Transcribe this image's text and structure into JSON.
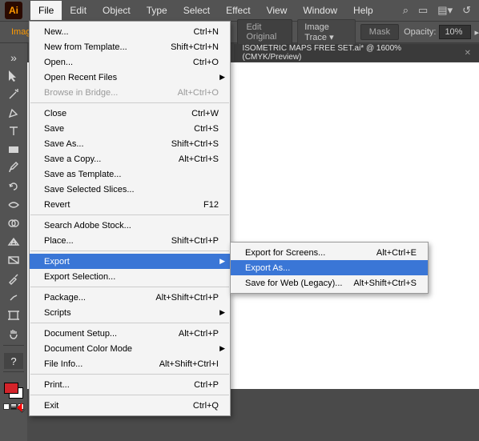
{
  "app": {
    "abbrev": "Ai"
  },
  "menubar": [
    "File",
    "Edit",
    "Object",
    "Type",
    "Select",
    "Effect",
    "View",
    "Window",
    "Help"
  ],
  "menubar_active_index": 0,
  "optbar": {
    "left_label": "Imag",
    "edit_original": "Edit Original",
    "image_trace": "Image Trace",
    "mask": "Mask",
    "opacity_label": "Opacity:",
    "opacity_value": "10%"
  },
  "tab": {
    "title": "ISOMETRIC MAPS FREE SET.ai* @ 1600% (CMYK/Preview)"
  },
  "file_menu": [
    {
      "label": "New...",
      "shortcut": "Ctrl+N"
    },
    {
      "label": "New from Template...",
      "shortcut": "Shift+Ctrl+N"
    },
    {
      "label": "Open...",
      "shortcut": "Ctrl+O"
    },
    {
      "label": "Open Recent Files",
      "submenu": true
    },
    {
      "label": "Browse in Bridge...",
      "shortcut": "Alt+Ctrl+O",
      "disabled": true
    },
    {
      "sep": true
    },
    {
      "label": "Close",
      "shortcut": "Ctrl+W"
    },
    {
      "label": "Save",
      "shortcut": "Ctrl+S"
    },
    {
      "label": "Save As...",
      "shortcut": "Shift+Ctrl+S"
    },
    {
      "label": "Save a Copy...",
      "shortcut": "Alt+Ctrl+S"
    },
    {
      "label": "Save as Template..."
    },
    {
      "label": "Save Selected Slices..."
    },
    {
      "label": "Revert",
      "shortcut": "F12"
    },
    {
      "sep": true
    },
    {
      "label": "Search Adobe Stock..."
    },
    {
      "label": "Place...",
      "shortcut": "Shift+Ctrl+P"
    },
    {
      "sep": true
    },
    {
      "label": "Export",
      "submenu": true,
      "hl": true
    },
    {
      "label": "Export Selection..."
    },
    {
      "sep": true
    },
    {
      "label": "Package...",
      "shortcut": "Alt+Shift+Ctrl+P"
    },
    {
      "label": "Scripts",
      "submenu": true
    },
    {
      "sep": true
    },
    {
      "label": "Document Setup...",
      "shortcut": "Alt+Ctrl+P"
    },
    {
      "label": "Document Color Mode",
      "submenu": true
    },
    {
      "label": "File Info...",
      "shortcut": "Alt+Shift+Ctrl+I"
    },
    {
      "sep": true
    },
    {
      "label": "Print...",
      "shortcut": "Ctrl+P"
    },
    {
      "sep": true
    },
    {
      "label": "Exit",
      "shortcut": "Ctrl+Q"
    }
  ],
  "export_menu": [
    {
      "label": "Export for Screens...",
      "shortcut": "Alt+Ctrl+E"
    },
    {
      "label": "Export As...",
      "hl": true
    },
    {
      "label": "Save for Web (Legacy)...",
      "shortcut": "Alt+Shift+Ctrl+S"
    }
  ],
  "help_tool": "?"
}
